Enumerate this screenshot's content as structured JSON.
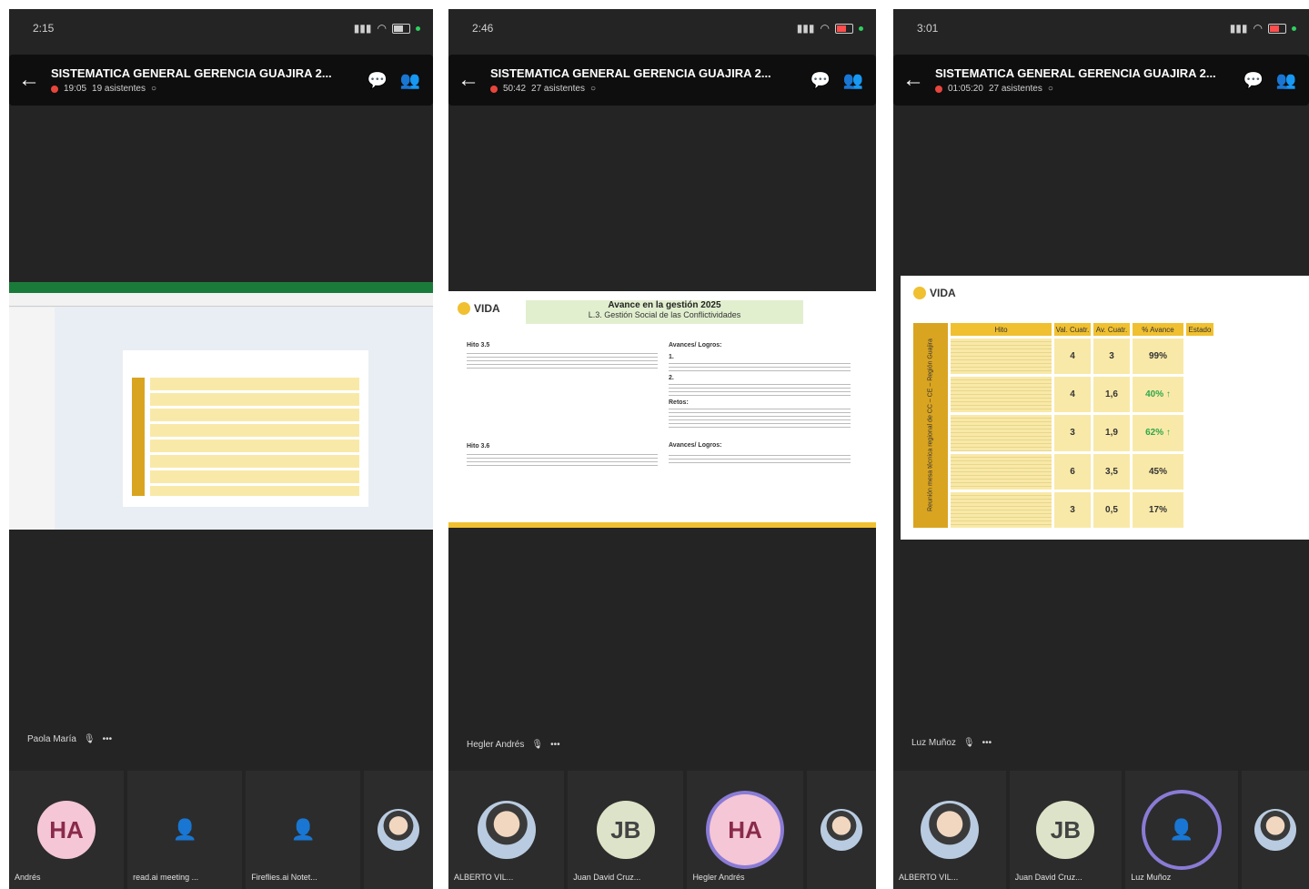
{
  "panels": [
    {
      "time": "2:15",
      "meeting_title": "SISTEMATICA GENERAL GERENCIA GUAJIRA 2...",
      "elapsed": "19:05",
      "attendees": "19 asistentes",
      "speaker": "Paola María",
      "tiles": [
        {
          "initials": "HA",
          "name": "Andrés"
        },
        {
          "name": "read.ai meeting ..."
        },
        {
          "name": "Fireflies.ai Notet..."
        },
        {
          "name": ""
        }
      ]
    },
    {
      "time": "2:46",
      "meeting_title": "SISTEMATICA GENERAL GERENCIA GUAJIRA 2...",
      "elapsed": "50:42",
      "attendees": "27 asistentes",
      "speaker": "Hegler Andrés",
      "slide": {
        "logo": "VIDA",
        "title": "Avance en la gestión 2025",
        "subtitle": "L.3. Gestión Social de las Conflictividades",
        "left_label": "Hito 3.5",
        "left_label2": "Hito 3.6",
        "logros_label": "Avances/ Logros:",
        "item1": "1.",
        "item2": "2.",
        "retos_label": "Retos:"
      },
      "tiles": [
        {
          "name": "ALBERTO VIL..."
        },
        {
          "initials": "JB",
          "name": "Juan David Cruz..."
        },
        {
          "initials": "HA",
          "name": "Hegler Andrés"
        },
        {
          "name": ""
        }
      ]
    },
    {
      "time": "3:01",
      "meeting_title": "SISTEMATICA GENERAL GERENCIA GUAJIRA 2...",
      "elapsed": "01:05:20",
      "attendees": "27 asistentes",
      "speaker": "Luz Muñoz",
      "slide": {
        "logo": "VIDA",
        "side_text": "Reunión mesa técnica regional de CC – CE – Región Guajira",
        "headers": [
          "Hito",
          "Val. Cuatr.",
          "Av. Cuatr.",
          "% Avance",
          "Estado"
        ],
        "rows": [
          [
            "4",
            "3",
            "99%"
          ],
          [
            "4",
            "1,6",
            "40% ↑"
          ],
          [
            "3",
            "1,9",
            "62% ↑"
          ],
          [
            "6",
            "3,5",
            "45%"
          ],
          [
            "3",
            "0,5",
            "17%"
          ]
        ]
      },
      "tiles": [
        {
          "name": "ALBERTO VIL..."
        },
        {
          "initials": "JB",
          "name": "Juan David Cruz..."
        },
        {
          "name": "Luz Muñoz"
        },
        {
          "name": ""
        }
      ]
    }
  ],
  "colors": {
    "bg": "#242424",
    "accent": "#f0c030",
    "record": "#e8453c"
  }
}
